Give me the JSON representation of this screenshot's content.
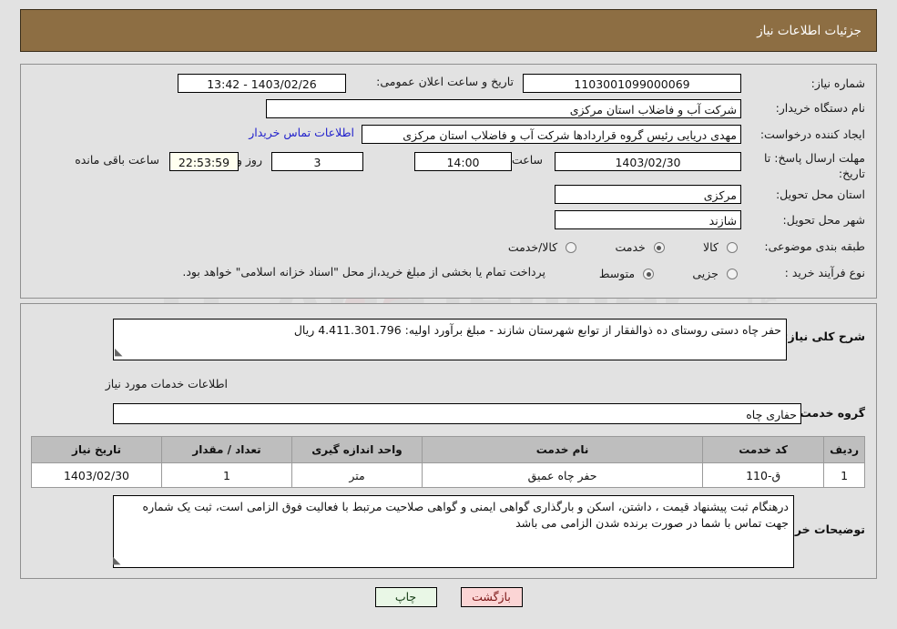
{
  "header": {
    "title": "جزئیات اطلاعات نیاز"
  },
  "top_form": {
    "need_number": {
      "label": "شماره نیاز:",
      "value": "1103001099000069"
    },
    "announce_datetime": {
      "label": "تاریخ و ساعت اعلان عمومی:",
      "value": "1403/02/26 - 13:42"
    },
    "buyer_org": {
      "label": "نام دستگاه خریدار:",
      "value": "شرکت آب و فاضلاب استان مرکزی"
    },
    "buyer_org_extra": {
      "value": "شرکت آب و فاضلاب استان مرکزی"
    },
    "requester": {
      "label": "ایجاد کننده درخواست:",
      "value": "مهدی دریایی رئیس گروه قراردادها شرکت آب و فاضلاب استان مرکزی"
    },
    "contact_link": {
      "label": "اطلاعات تماس خریدار"
    },
    "deadline": {
      "label": "مهلت ارسال پاسخ: تا تاریخ:",
      "date": "1403/02/30",
      "time_label": "ساعت",
      "time": "14:00",
      "days": "3",
      "days_label": "روز و",
      "countdown": "22:53:59",
      "remaining_label": "ساعت باقی مانده"
    },
    "province": {
      "label": "استان محل تحویل:",
      "value": "مرکزی"
    },
    "city": {
      "label": "شهر محل تحویل:",
      "value": "شازند"
    },
    "category": {
      "label": "طبقه بندی موضوعی:",
      "options": [
        "کالا",
        "خدمت",
        "کالا/خدمت"
      ],
      "selected": "خدمت"
    },
    "purchase_type": {
      "label": "نوع فرآیند خرید :",
      "options": [
        "جزیی",
        "متوسط"
      ],
      "selected": "متوسط",
      "note": "پرداخت تمام یا بخشی از مبلغ خرید،از محل \"اسناد خزانه اسلامی\" خواهد بود."
    }
  },
  "description": {
    "label": "شرح کلی نیاز:",
    "value": "حفر چاه دستی روستای ده ذوالفقار از توابع شهرستان شازند - مبلغ برآورد اولیه: 4.411.301.796 ریال"
  },
  "services_section": {
    "title": "اطلاعات خدمات مورد نیاز",
    "service_group": {
      "label": "گروه خدمت:",
      "value": "حفاری چاه"
    }
  },
  "table": {
    "headers": [
      "ردیف",
      "کد خدمت",
      "نام خدمت",
      "واحد اندازه گیری",
      "تعداد / مقدار",
      "تاریخ نیاز"
    ],
    "rows": [
      [
        "1",
        "ق-110",
        "حفر چاه عمیق",
        "متر",
        "1",
        "1403/02/30"
      ]
    ]
  },
  "buyer_notes": {
    "label": "توضیحات خریدار:",
    "value": "درهنگام ثبت پیشنهاد قیمت ، داشتن، اسکن و بارگذاری گواهی ایمنی و گواهی صلاحیت مرتبط با فعالیت فوق الزامی است، ثبت یک شماره جهت تماس با شما در صورت برنده شدن الزامی می باشد"
  },
  "footer": {
    "print_label": "چاپ",
    "back_label": "بازگشت"
  },
  "watermark": {
    "text": "AriaTender.ir"
  },
  "colors": {
    "header_brown": "#8D6E43",
    "panel_bg": "#E2E2E2",
    "link_blue": "#2222CC",
    "table_header": "#BEBEBE",
    "print_btn": "#E9F7E6",
    "back_btn": "#FBD5D5",
    "timer_bg": "#FFFFF0"
  }
}
